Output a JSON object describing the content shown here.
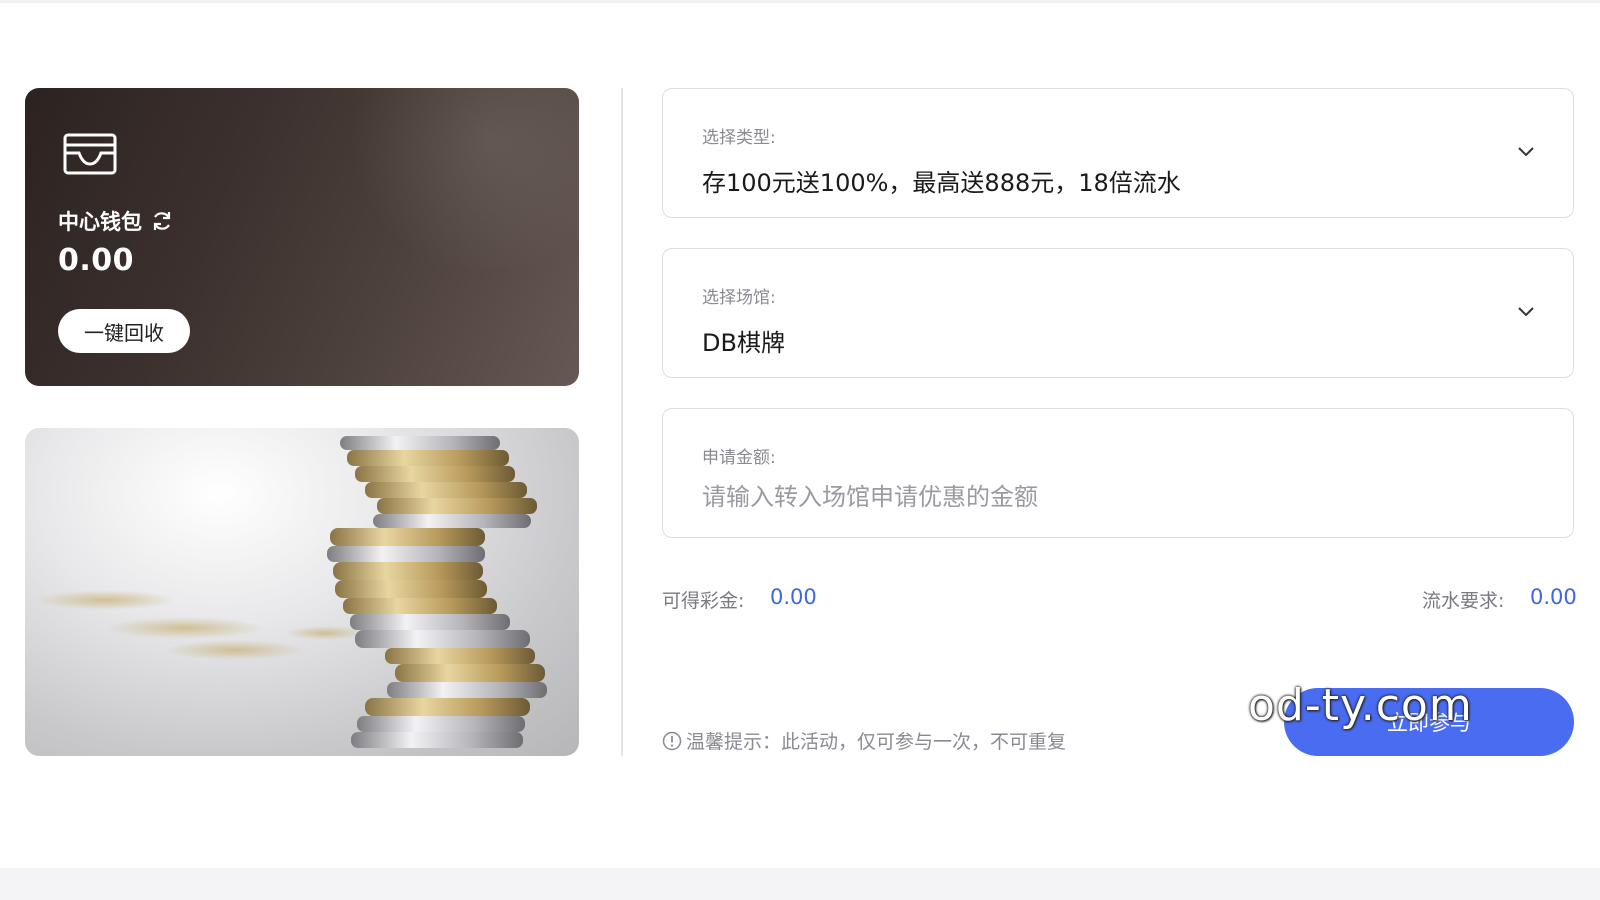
{
  "wallet": {
    "label": "中心钱包",
    "balance": "0.00",
    "recycle_label": "一键回收",
    "icons": [
      "wallet-icon",
      "refresh-icon"
    ]
  },
  "form": {
    "type": {
      "label": "选择类型:",
      "value": "存100元送100%，最高送888元，18倍流水"
    },
    "venue": {
      "label": "选择场馆:",
      "value": "DB棋牌"
    },
    "amount": {
      "label": "申请金额:",
      "placeholder": "请输入转入场馆申请优惠的金额"
    }
  },
  "stats": {
    "bonus_label": "可得彩金:",
    "bonus_value": "0.00",
    "turnover_label": "流水要求:",
    "turnover_value": "0.00"
  },
  "tip": "温馨提示：此活动，仅可参与一次，不可重复",
  "join_label": "立即参与",
  "watermark": "od-ty.com",
  "colors": {
    "accent": "#4a6cf1",
    "value_blue": "#3d66e8",
    "card_dark": "#2c2321"
  }
}
